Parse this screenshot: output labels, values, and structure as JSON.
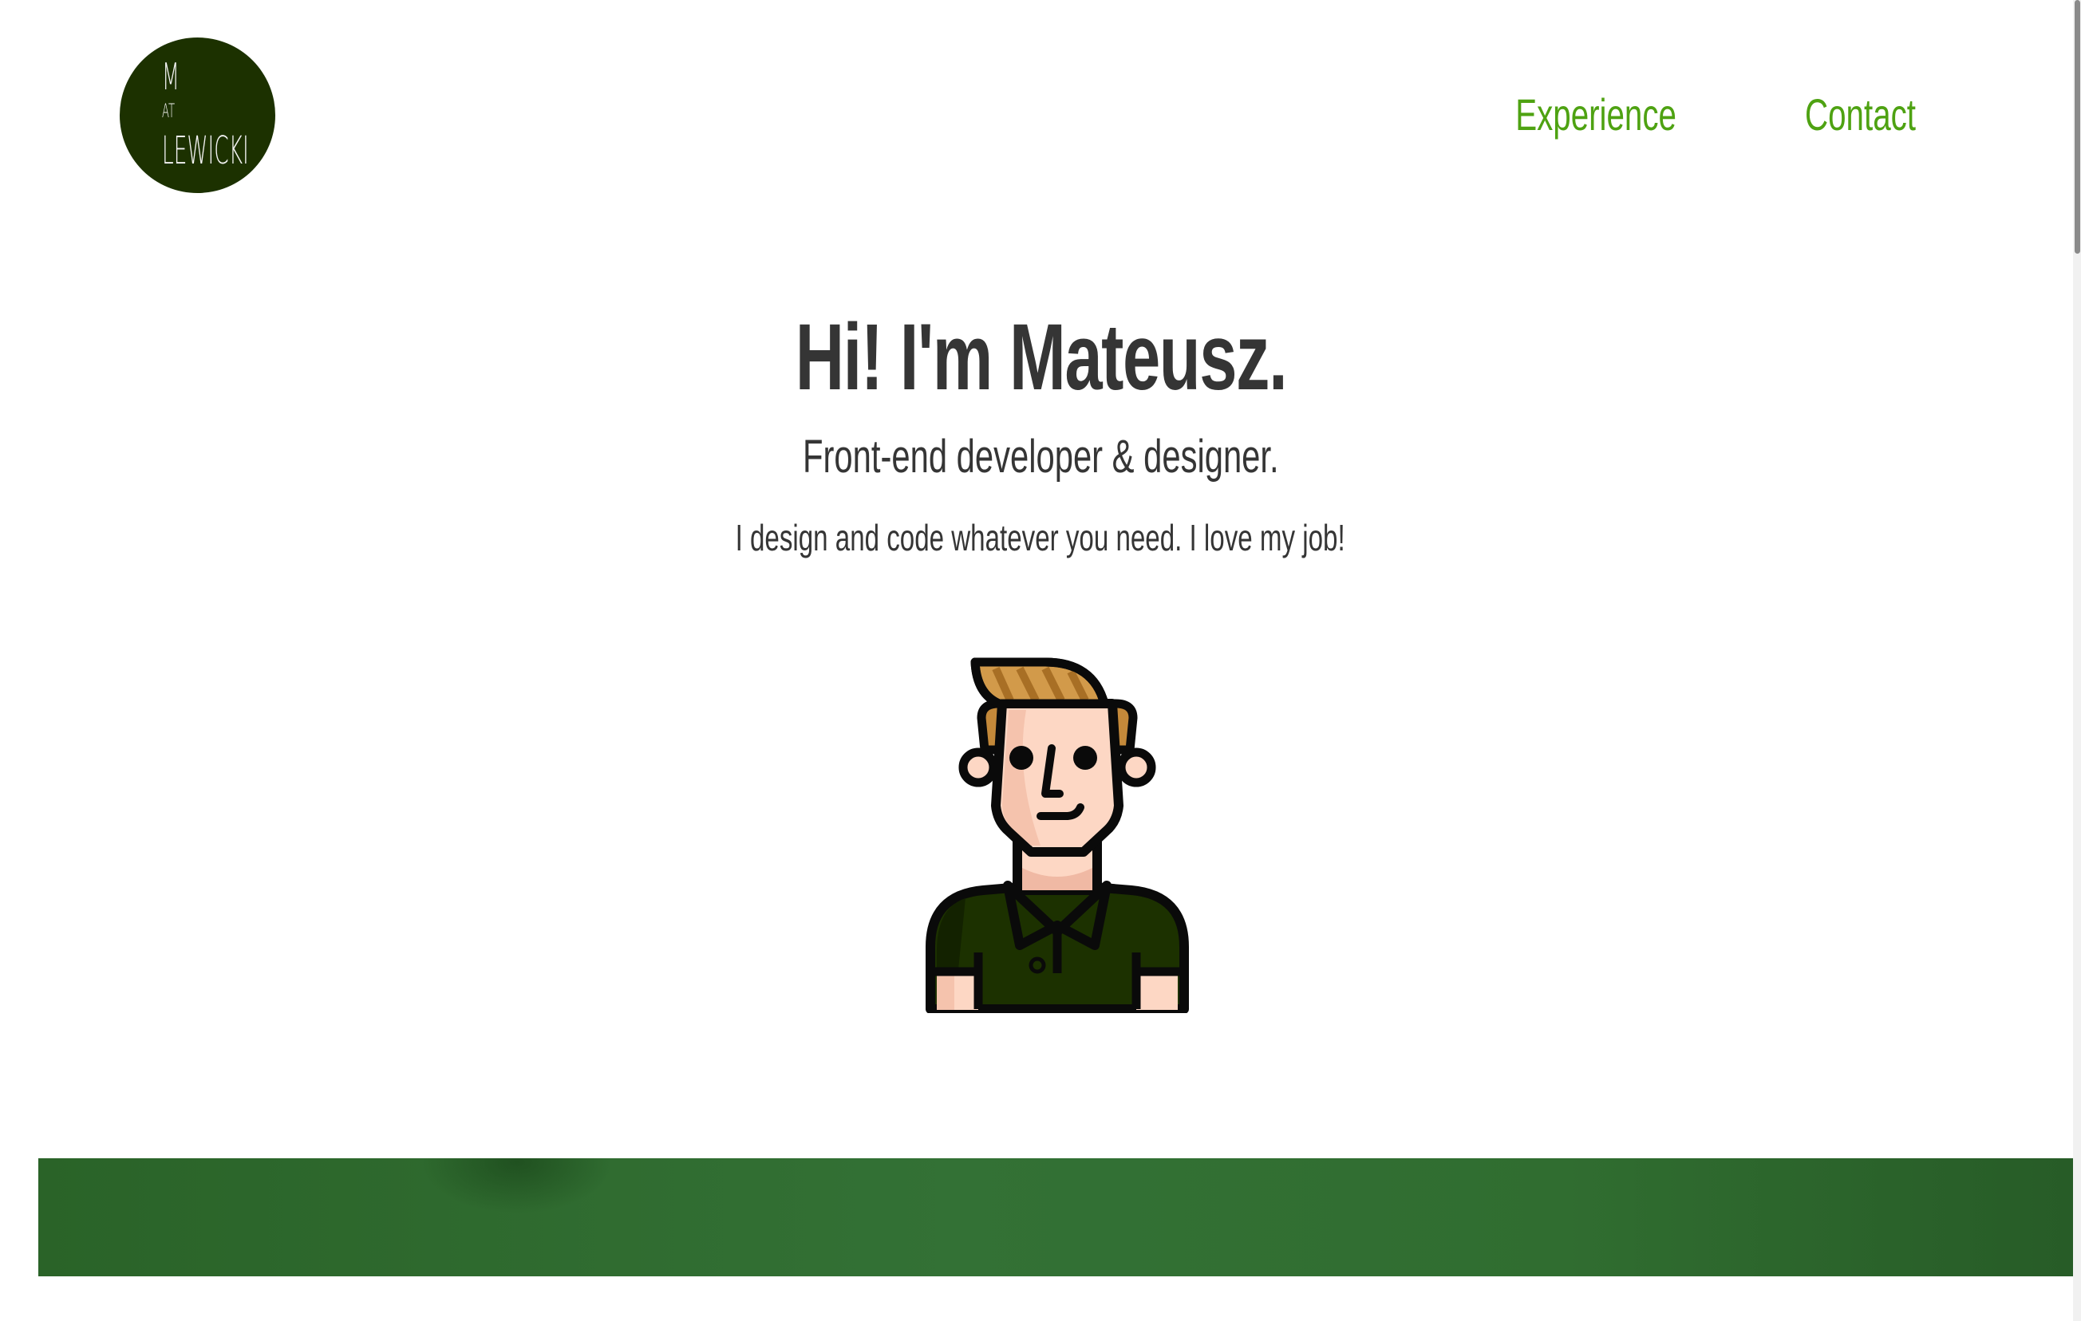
{
  "logo": {
    "line1": "M",
    "line2": "AT",
    "line3": "LEWICKI"
  },
  "nav": {
    "items": [
      {
        "label": "Experience"
      },
      {
        "label": "Contact"
      }
    ]
  },
  "hero": {
    "title": "Hi! I'm Mateusz.",
    "subtitle": "Front-end developer & designer.",
    "text": "I design and code whatever you need. I love my job!"
  },
  "colors": {
    "logo_bg": "#1c3100",
    "nav_link": "#4ea212",
    "heading_text": "#353535",
    "banner_green": "#306d30",
    "shirt": "#1c3100",
    "hair": "#c4893a",
    "skin": "#fdd7c4"
  },
  "icons": {
    "avatar": "developer-avatar-illustration"
  }
}
